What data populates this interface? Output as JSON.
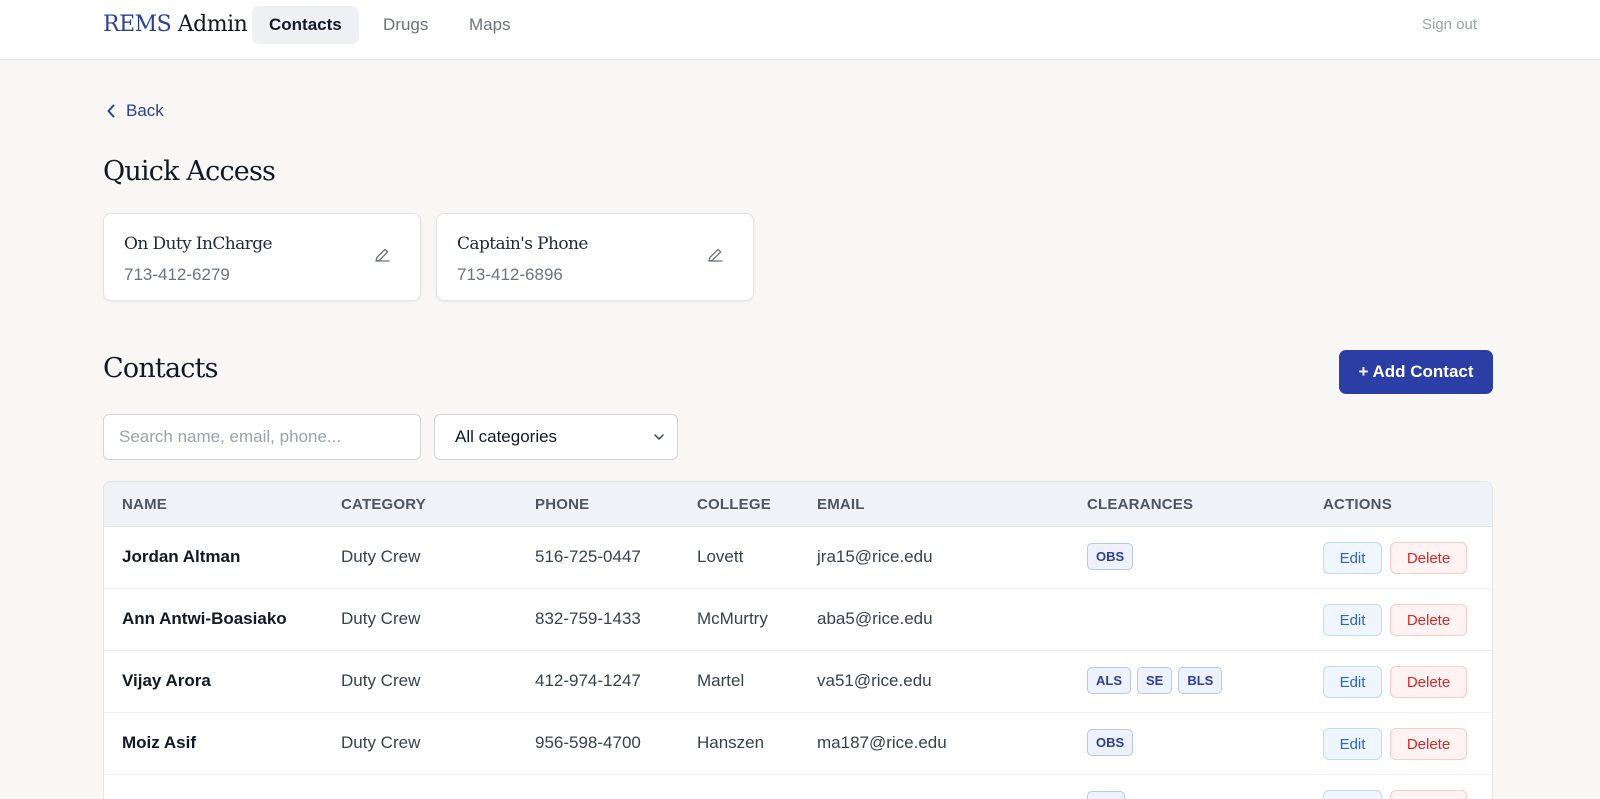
{
  "brand": {
    "part1": "REMS",
    "part2": "Admin"
  },
  "nav": {
    "tabs": [
      {
        "label": "Contacts",
        "active": true
      },
      {
        "label": "Drugs",
        "active": false
      },
      {
        "label": "Maps",
        "active": false
      }
    ],
    "signout": "Sign out"
  },
  "back_label": "Back",
  "quick_access": {
    "title": "Quick Access",
    "cards": [
      {
        "label": "On Duty InCharge",
        "phone": "713-412-6279",
        "icon": "pencil-icon"
      },
      {
        "label": "Captain's Phone",
        "phone": "713-412-6896",
        "icon": "pencil-icon"
      }
    ]
  },
  "contacts": {
    "title": "Contacts",
    "add_button": "+ Add Contact",
    "search_placeholder": "Search name, email, phone...",
    "search_value": "",
    "category_filter": "All categories",
    "columns": [
      "NAME",
      "CATEGORY",
      "PHONE",
      "COLLEGE",
      "EMAIL",
      "CLEARANCES",
      "ACTIONS"
    ],
    "rows": [
      {
        "name": "Jordan Altman",
        "category": "Duty Crew",
        "phone": "516-725-0447",
        "college": "Lovett",
        "email": "jra15@rice.edu",
        "clearances": [
          "OBS"
        ]
      },
      {
        "name": "Ann Antwi-Boasiako",
        "category": "Duty Crew",
        "phone": "832-759-1433",
        "college": "McMurtry",
        "email": "aba5@rice.edu",
        "clearances": []
      },
      {
        "name": "Vijay Arora",
        "category": "Duty Crew",
        "phone": "412-974-1247",
        "college": "Martel",
        "email": "va51@rice.edu",
        "clearances": [
          "ALS",
          "SE",
          "BLS"
        ]
      },
      {
        "name": "Moiz Asif",
        "category": "Duty Crew",
        "phone": "956-598-4700",
        "college": "Hanszen",
        "email": "ma187@rice.edu",
        "clearances": [
          "OBS"
        ]
      }
    ],
    "edit_label": "Edit",
    "delete_label": "Delete"
  },
  "colors": {
    "accent": "#2b3ea5",
    "background": "#f8f7f5",
    "edit": "#2563eb",
    "delete": "#dc2626"
  }
}
